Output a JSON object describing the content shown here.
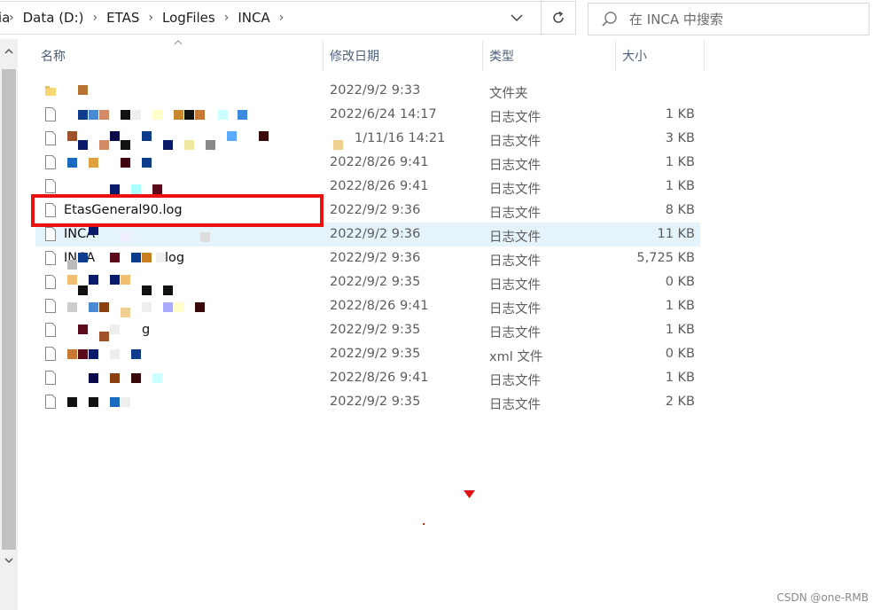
{
  "address_bar": {
    "prefix": "ia",
    "crumbs": [
      "Data (D:)",
      "ETAS",
      "LogFiles",
      "INCA"
    ]
  },
  "search": {
    "placeholder": "在 INCA 中搜索"
  },
  "columns": {
    "name": "名称",
    "date": "修改日期",
    "type": "类型",
    "size": "大小"
  },
  "rows": [
    {
      "name": "",
      "date": "2022/9/2 9:33",
      "type": "文件夹",
      "size": "",
      "icon": "folder-icon"
    },
    {
      "name": "",
      "date": "2022/6/24 14:17",
      "type": "日志文件",
      "size": "1 KB",
      "icon": "file-icon"
    },
    {
      "name": "",
      "date": "1/11/16 14:21",
      "type": "日志文件",
      "size": "3 KB",
      "icon": "file-icon"
    },
    {
      "name": "",
      "date": "2022/8/26 9:41",
      "type": "日志文件",
      "size": "1 KB",
      "icon": "file-icon"
    },
    {
      "name": "",
      "date": "2022/8/26 9:41",
      "type": "日志文件",
      "size": "1 KB",
      "icon": "file-icon"
    },
    {
      "name": "EtasGeneral90.log",
      "date": "2022/9/2 9:36",
      "type": "日志文件",
      "size": "8 KB",
      "icon": "file-icon"
    },
    {
      "name": "INCA",
      "date": "2022/9/2 9:36",
      "type": "日志文件",
      "size": "11 KB",
      "icon": "file-icon",
      "selected": true
    },
    {
      "name": "INCA",
      "date": "2022/9/2 9:36",
      "type": "日志文件",
      "size": "5,725 KB",
      "icon": "file-icon"
    },
    {
      "name": "",
      "date": "2022/9/2 9:35",
      "type": "日志文件",
      "size": "0 KB",
      "icon": "file-icon"
    },
    {
      "name": "",
      "date": "2022/8/26 9:41",
      "type": "日志文件",
      "size": "1 KB",
      "icon": "file-icon"
    },
    {
      "name": "",
      "date": "2022/9/2 9:35",
      "type": "日志文件",
      "size": "1 KB",
      "icon": "file-icon"
    },
    {
      "name": "",
      "date": "2022/9/2 9:35",
      "type": "xml 文件",
      "size": "0 KB",
      "icon": "file-icon"
    },
    {
      "name": "",
      "date": "2022/8/26 9:41",
      "type": "日志文件",
      "size": "1 KB",
      "icon": "file-icon"
    },
    {
      "name": "",
      "date": "2022/9/2 9:35",
      "type": "日志文件",
      "size": "2 KB",
      "icon": "file-icon"
    }
  ],
  "watermark": "CSDN @one-RMB",
  "colors": {
    "highlight": "#ee1111",
    "selected_row": "#e5f3fb",
    "header_text": "#4c607a"
  }
}
